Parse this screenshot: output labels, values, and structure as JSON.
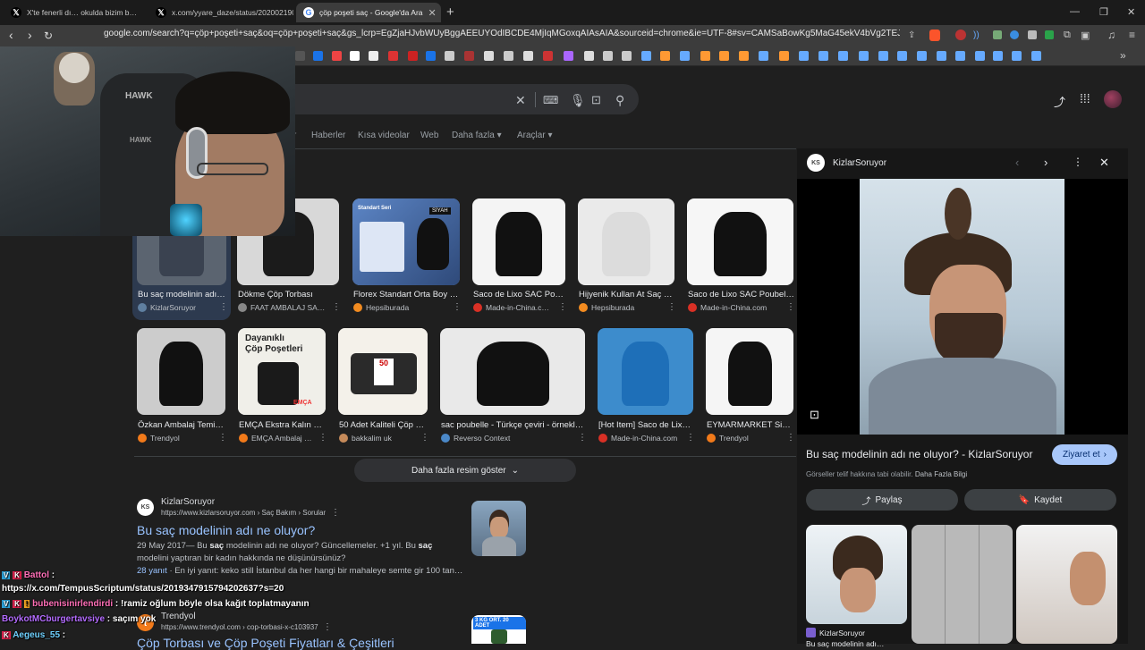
{
  "tabs": [
    {
      "label": "X'te fenerli dı… okulda bizim b…",
      "icon": "x-logo-icon"
    },
    {
      "label": "x.com/yyare_daze/status/20200219000…",
      "icon": "x-logo-icon"
    },
    {
      "label": "çöp poşeti saç - Google'da Ara",
      "icon": "google-icon",
      "active": true
    }
  ],
  "address_bar": {
    "url": "google.com/search?q=çöp+poşeti+saç&oq=çöp+poşeti+saç&gs_lcrp=EgZjaHJvbWUyBggAEEUYOdIBCDE4MjIqMGoxqAIAsAIA&sourceid=chrome&ie=UTF-8#sv=CAMSaBowKg5MaG45ekV4bVg2TEJFTTIOTGhuOXp…"
  },
  "filters": [
    "r",
    "Haberler",
    "Kısa videolar",
    "Web",
    "Daha fazla",
    "Araçlar"
  ],
  "images_row1": [
    {
      "caption": "Bu saç modelinin adı…",
      "source": "KizlarSoruyor",
      "color": "#5f7fa0",
      "bg": "#5b6470",
      "selected": true
    },
    {
      "caption": "Dökme Çöp Torbası",
      "source": "FAAT AMBALAJ SA…",
      "color": "#888888",
      "bg": "#d8d8d8"
    },
    {
      "caption": "Florex Standart Orta Boy …",
      "source": "Hepsiburada",
      "color": "#f28b20",
      "bg": "#6d8fc0"
    },
    {
      "caption": "Saco de Lixo SAC Po…",
      "source": "Made-in-China.c…",
      "color": "#d93025",
      "bg": "#f4f4f4"
    },
    {
      "caption": "Hijyenik Kullan At Saç …",
      "source": "Hepsiburada",
      "color": "#f28b20",
      "bg": "#eaeaea"
    },
    {
      "caption": "Saco de Lixo SAC Poubel…",
      "source": "Made-in-China.com",
      "color": "#d93025",
      "bg": "#f6f6f6"
    }
  ],
  "images_row2": [
    {
      "caption": "Özkan Ambalaj Temi…",
      "source": "Trendyol",
      "color": "#f27a1a",
      "bg": "#cccccc"
    },
    {
      "caption": "EMÇA Ekstra Kalın …",
      "source": "EMÇA Ambalaj …",
      "color": "#f27a1a",
      "bg": "#efefef"
    },
    {
      "caption": "50 Adet Kaliteli Çöp …",
      "source": "bakkalim uk",
      "color": "#c58a5a",
      "bg": "#f3efe6"
    },
    {
      "caption": "sac poubelle - Türkçe çeviri - örnekl…",
      "source": "Reverso Context",
      "color": "#4b88c8",
      "bg": "#e9e9e9"
    },
    {
      "caption": "[Hot Item] Saco de Lix…",
      "source": "Made-in-China.com",
      "color": "#d93025",
      "bg": "#3d8ccc"
    },
    {
      "caption": "EYMARMARKET Si…",
      "source": "Trendyol",
      "color": "#f27a1a",
      "bg": "#f5f5f5"
    }
  ],
  "more_images_label": "Daha fazla resim göster",
  "thumb_text": {
    "florex_badge": "Standart Seri",
    "florex_siyah": "SİYAH",
    "dayanikli_line1": "Dayanıklı",
    "dayanikli_line2": "Çöp Poşetleri",
    "emca_logo": "EMÇA",
    "fifty": "50",
    "adet": "50 Adet"
  },
  "result1": {
    "site": "KizlarSoruyor",
    "url": "https://www.kizlarsoruyor.com › Saç Bakım › Sorular",
    "title": "Bu saç modelinin adı ne oluyor?",
    "date": "29 May 2017",
    "snippet_a": "— Bu ",
    "snippet_b": "saç",
    "snippet_c": " modelinin adı ne oluyor? Güncellemeler. +1 yıl. Bu ",
    "snippet_d": "saç",
    "snippet_e": "modelini yaptıran bir kadın hakkında ne düşünürsünüz?",
    "answers": "28 yanıt",
    "answer_snippet": "· En iyi yanıt: keko still İstanbul da her hangi bir mahaleye semte gir 100 tan…"
  },
  "result2": {
    "site": "Trendyol",
    "url": "https://www.trendyol.com › cop-torbasi-x-c103937",
    "title": "Çöp Torbası ve Çöp Poşeti Fiyatları & Çeşitleri",
    "badge": "3 KG ORT. 20 ADET"
  },
  "panel": {
    "source": "KizlarSoruyor",
    "title": "Bu saç modelinin adı ne oluyor? - KizlarSoruyor",
    "visit": "Ziyaret et",
    "notice": "Görseller telif hakkına tabi olabilir.",
    "more_info": "Daha Fazla Bilgi",
    "share": "Paylaş",
    "save": "Kaydet",
    "related_source": "KizlarSoruyor",
    "related_caption": "Bu saç modelinin adı…"
  },
  "webcam": {
    "chair_brand": "HAWK",
    "chair_brand_small": "HAWK"
  },
  "chat": [
    {
      "user": "Battol",
      "sep": " :",
      "color": "#ff6fb7",
      "badges": [
        "V",
        "K"
      ]
    },
    {
      "user": "",
      "text": "https://x.com/TempusScriptum/status/2019347915794202637?s=20",
      "color": "#ffffff"
    },
    {
      "user": "bubenisinirlendirdi",
      "text": " : !ramiz oğlum böyle olsa kağıt toplatmayanın",
      "color": "#ff6fb7",
      "badges": [
        "V",
        "K",
        "!"
      ]
    },
    {
      "user": "BoykotMCburgertavsiye",
      "text": " : saçım yok",
      "color": "#b46cff"
    },
    {
      "user": "Aegeus_55",
      "text": " :",
      "color": "#6fd1ff",
      "badges": [
        "K"
      ]
    }
  ],
  "colors": {
    "page_bg": "#1f1f1f",
    "link": "#99c3ff",
    "accent": "#8ab4f8",
    "visit_btn": "#a8c7fa"
  }
}
